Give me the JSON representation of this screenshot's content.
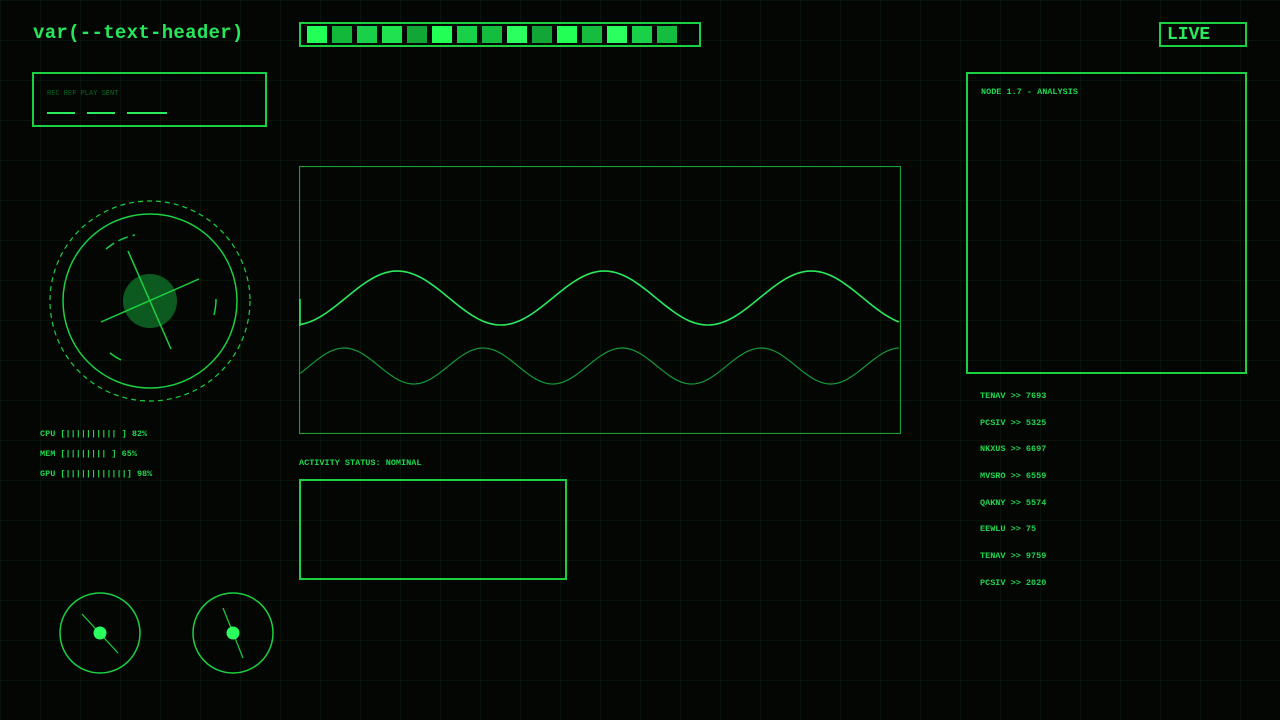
{
  "header": {
    "title": "var(--text-header)",
    "live_label": "LIVE"
  },
  "segment_bar": {
    "colors": [
      "#22ff55",
      "#11b83a",
      "#19d148",
      "#1ee24e",
      "#11a636",
      "#22ff55",
      "#19d148",
      "#15bd3f",
      "#2bff60",
      "#11a636",
      "#22ff55",
      "#15bd3f",
      "#2bff60",
      "#19d148",
      "#15bd3f"
    ]
  },
  "rec_panel": {
    "label": "REC  REF  PLAY  SENT"
  },
  "radar": {
    "name": "radar-scope"
  },
  "system_stats": [
    {
      "label": "CPU",
      "bar": "[|||||||||| ]",
      "value": "82%"
    },
    {
      "label": "MEM",
      "bar": "[|||||||| ]",
      "value": "65%"
    },
    {
      "label": "GPU",
      "bar": "[||||||||||||]",
      "value": "98%"
    }
  ],
  "activity": {
    "status": "ACTIVITY STATUS: NOMINAL"
  },
  "analysis": {
    "title": "NODE 1.7 - ANALYSIS"
  },
  "node_readouts": [
    {
      "name": "TENAV",
      "value": "7693"
    },
    {
      "name": "PCSIV",
      "value": "5325"
    },
    {
      "name": "NKXUS",
      "value": "6697"
    },
    {
      "name": "MVSRO",
      "value": "6559"
    },
    {
      "name": "QAKNY",
      "value": "5574"
    },
    {
      "name": "EEWLU",
      "value": "75"
    },
    {
      "name": "TENAV",
      "value": "9759"
    },
    {
      "name": "PCSIV",
      "value": "2020"
    }
  ],
  "colors": {
    "primary": "#1bd141",
    "bright": "#2bea5e",
    "dim": "#0f6a25",
    "background": "#030603"
  }
}
